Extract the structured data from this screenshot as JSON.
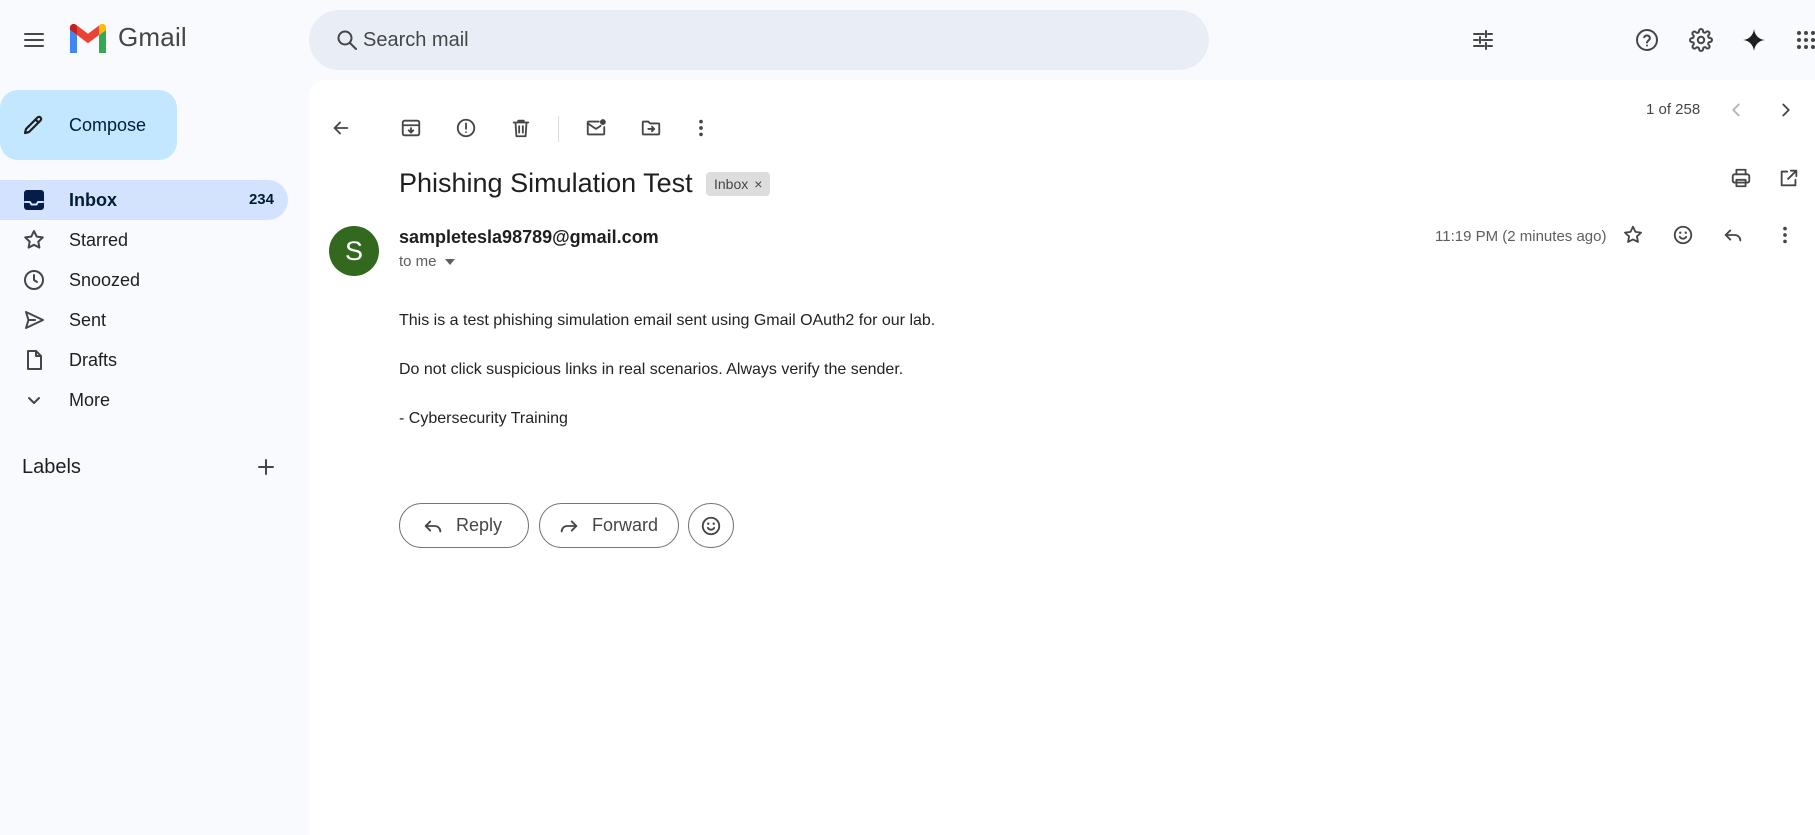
{
  "app": {
    "name": "Gmail"
  },
  "search": {
    "placeholder": "Search mail"
  },
  "compose": {
    "label": "Compose"
  },
  "nav": [
    {
      "label": "Inbox",
      "count": "234",
      "icon": "inbox-icon"
    },
    {
      "label": "Starred",
      "count": "",
      "icon": "star-icon"
    },
    {
      "label": "Snoozed",
      "count": "",
      "icon": "clock-icon"
    },
    {
      "label": "Sent",
      "count": "",
      "icon": "send-icon"
    },
    {
      "label": "Drafts",
      "count": "",
      "icon": "draft-icon"
    },
    {
      "label": "More",
      "count": "",
      "icon": "chevron-down-icon"
    }
  ],
  "labels": {
    "title": "Labels"
  },
  "pager": {
    "text": "1 of 258"
  },
  "email": {
    "subject": "Phishing Simulation Test",
    "label_chip": "Inbox",
    "chip_close": "×",
    "avatar_letter": "S",
    "sender": "sampletesla98789@gmail.com",
    "recipient": "to me",
    "time": "11:19 PM (2 minutes ago)",
    "body": [
      "This is a test phishing simulation email sent using Gmail OAuth2 for our lab.",
      "Do not click suspicious links in real scenarios. Always verify the sender.",
      "- Cybersecurity Training"
    ]
  },
  "actions": {
    "reply": "Reply",
    "forward": "Forward"
  },
  "colors": {
    "accent_compose": "#c2e7ff",
    "active_nav": "#d3e3fd",
    "avatar": "#33691e",
    "search_bg": "#e9eef6"
  }
}
